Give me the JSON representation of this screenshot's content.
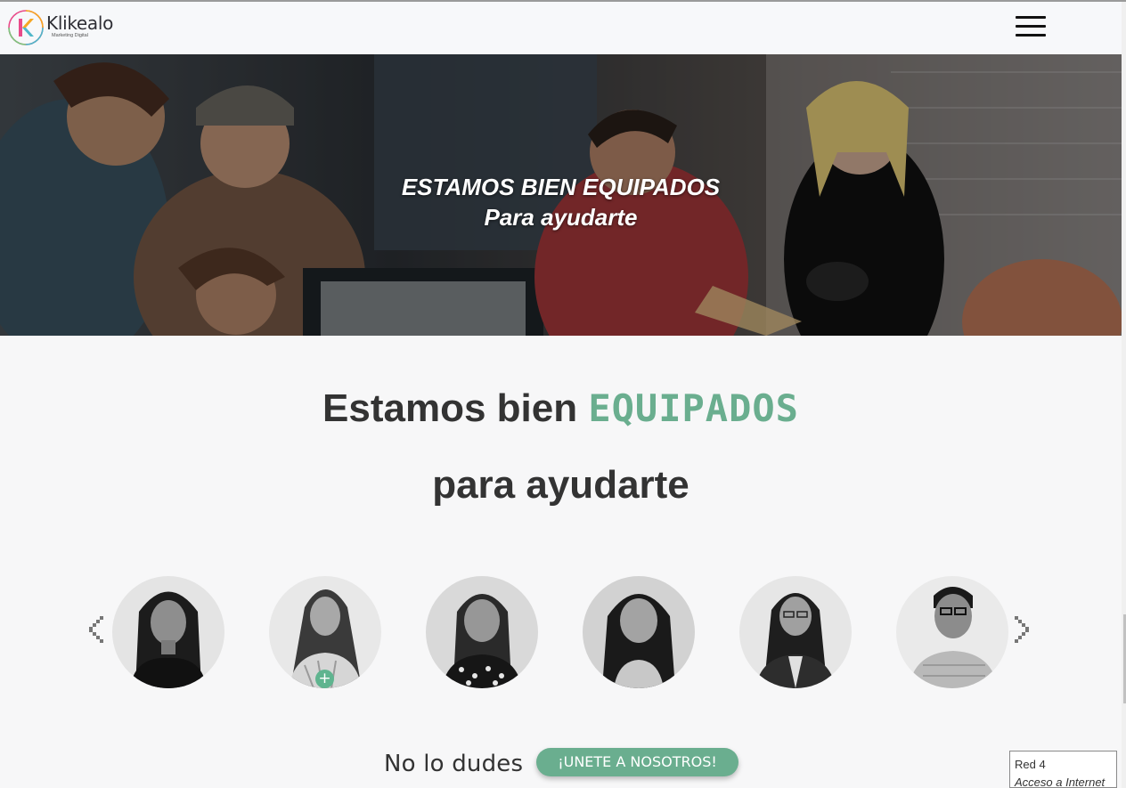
{
  "header": {
    "logo_name": "Klikealo",
    "logo_tagline": "Marketing Digital",
    "menu_icon": "hamburger-icon"
  },
  "hero": {
    "line1": "ESTAMOS BIEN EQUIPADOS",
    "line2": "Para ayudarte"
  },
  "team_section": {
    "title_prefix": "Estamos bien ",
    "title_accent": "EQUIPADOS",
    "title_line2": "para ayudarte",
    "prev_icon": "chevron-left-icon",
    "next_icon": "chevron-right-icon",
    "members_count_visible": 6,
    "badge_symbol": "+"
  },
  "cta": {
    "text": "No lo dudes",
    "button_label": "¡UNETE A NOSOTROS!"
  },
  "network_tooltip": {
    "line1": "Red  4",
    "line2": "Acceso a Internet"
  },
  "colors": {
    "accent": "#6aae8f",
    "background": "#f7f7f8",
    "text": "#333333"
  }
}
